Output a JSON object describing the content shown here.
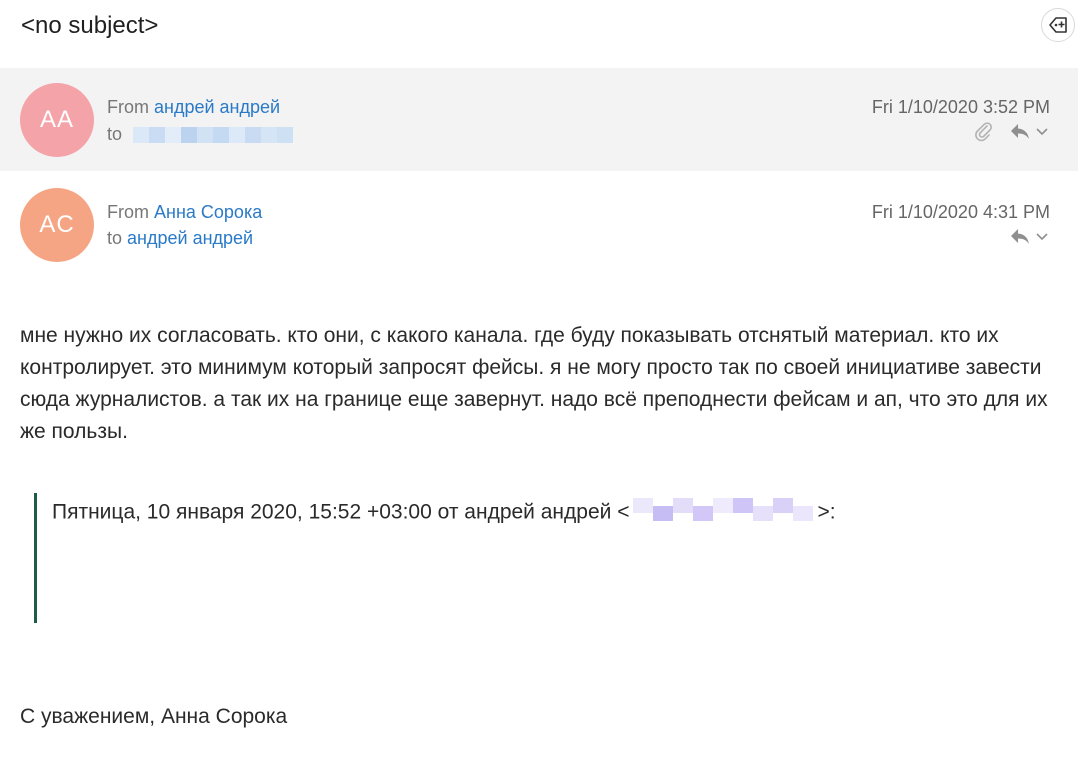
{
  "subject": "<no subject>",
  "messages": [
    {
      "initials": "AA",
      "avatar_color": "#f4a3a8",
      "from_label": "From",
      "from_name": "андрей андрей",
      "to_label": "to",
      "date": "Fri 1/10/2020 3:52 PM",
      "has_attachment": true
    },
    {
      "initials": "AC",
      "avatar_color": "#f5a583",
      "from_label": "From",
      "from_name": "Анна Сорока",
      "to_label": "to",
      "to_name": "андрей андрей",
      "date": "Fri 1/10/2020 4:31 PM"
    }
  ],
  "body": "мне нужно их согласовать. кто они, с какого канала. где буду показывать отснятый материал. кто их контролирует. это минимум который запросят фейсы. я не могу просто так по своей инициативе завести сюда журналистов. а так их на границе еще завернут. надо всё преподнести фейсам и ап, что это для их же пользы.",
  "quote": {
    "header_prefix": "Пятница, 10 января 2020, 15:52 +03:00 от андрей андрей <",
    "header_suffix": ">:"
  },
  "signature": "С уважением, Анна Сорока",
  "icons": {
    "tag": "tag-add-icon",
    "attachment": "paperclip-icon",
    "reply": "reply-icon",
    "more": "chevron-down-icon"
  }
}
